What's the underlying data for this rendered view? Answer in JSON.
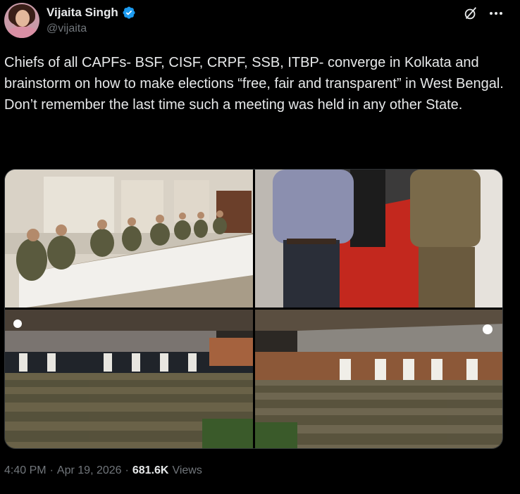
{
  "author": {
    "display_name": "Vijaita Singh",
    "handle": "@vijaita",
    "verified_color": "#1d9bf0"
  },
  "icons": {
    "grok": "grok-icon",
    "more": "more-icon",
    "verified": "verified-badge-icon"
  },
  "tweet": {
    "text": "Chiefs of all CAPFs- BSF, CISF, CRPF, SSB, ITBP- converge in Kolkata and brainstorm on how to make elections “free, fair and transparent” in West Bengal.\nDon’t remember the last time such a meeting was held in any other State."
  },
  "media": {
    "count": 4
  },
  "meta": {
    "time": "4:40 PM",
    "separator": "·",
    "date": "Apr 19, 2026",
    "views_count": "681.6K",
    "views_label": "Views"
  }
}
